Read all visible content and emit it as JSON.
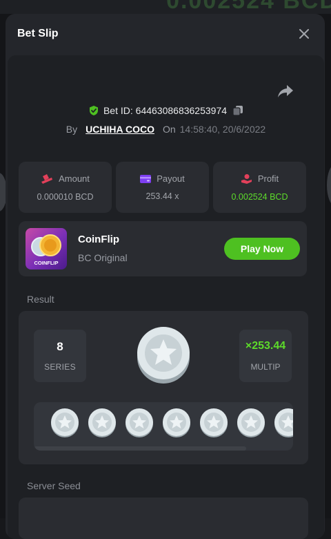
{
  "modal": {
    "title": "Bet Slip"
  },
  "bet": {
    "id_label": "Bet ID: ",
    "id_value": "64463086836253974",
    "by_label": "By",
    "user": "UCHIHA COCO",
    "on_label": "On",
    "time": "14:58:40, 20/6/2022"
  },
  "stats": [
    {
      "label": "Amount",
      "value": "0.000010 BCD",
      "icon": "coins-icon"
    },
    {
      "label": "Payout",
      "value": "253.44 x",
      "icon": "wallet-icon"
    },
    {
      "label": "Profit",
      "value": "0.002524 BCD",
      "icon": "hand-coin-icon"
    }
  ],
  "game": {
    "name": "CoinFlip",
    "provider": "BC Original",
    "thumb_text": "COINFLIP",
    "play_label": "Play Now"
  },
  "result": {
    "label": "Result",
    "series_value": "8",
    "series_label": "SERIES",
    "multiplier": "×253.44",
    "multiplier_label": "MULTIP"
  },
  "seed": {
    "label": "Server Seed"
  },
  "colors": {
    "accent_green": "#4ec021",
    "profit_green": "#5ddc2a",
    "panel": "#24262b"
  }
}
